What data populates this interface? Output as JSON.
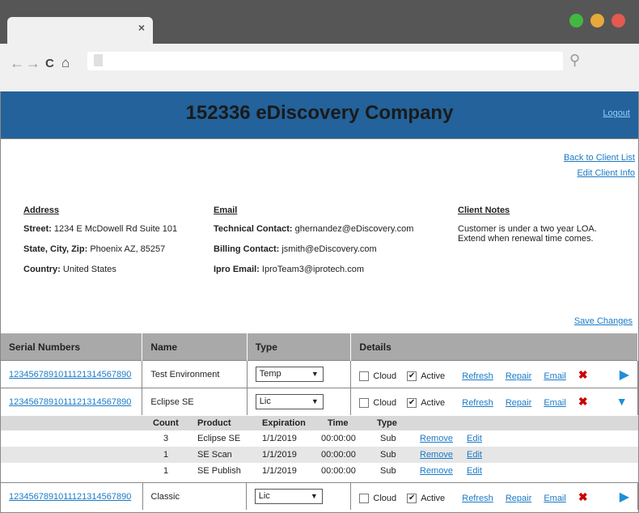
{
  "browser": {
    "tab_close": "×",
    "dots": [
      "#42b842",
      "#e8a93a",
      "#e35a4f"
    ],
    "nav": {
      "back": "←",
      "forward": "→",
      "reload": "C",
      "home": "⌂",
      "search": "⚲"
    }
  },
  "header": {
    "title": "152336 eDiscovery Company",
    "logout": "Logout"
  },
  "links": {
    "back": "Back to Client List",
    "edit": "Edit Client Info",
    "save": "Save Changes"
  },
  "address": {
    "heading": "Address",
    "street_label": "Street:",
    "street": "1234 E McDowell Rd Suite 101",
    "city_label": "State, City, Zip:",
    "city": "Phoenix AZ, 85257",
    "country_label": "Country:",
    "country": "United States"
  },
  "email": {
    "heading": "Email",
    "tech_label": "Technical Contact:",
    "tech": "ghernandez@eDiscovery.com",
    "billing_label": "Billing Contact:",
    "billing": "jsmith@eDiscovery.com",
    "ipro_label": "Ipro Email:",
    "ipro": "IproTeam3@iprotech.com"
  },
  "notes": {
    "heading": "Client Notes",
    "line1": "Customer is under a two year LOA.",
    "line2": "Extend when renewal time comes."
  },
  "table": {
    "headers": [
      "Serial Numbers",
      "Name",
      "Type",
      "Details"
    ],
    "rows": [
      {
        "serial": "1234567891011121314567890",
        "name": "Test Environment",
        "type": "Temp",
        "cloud": "Cloud",
        "active": "Active"
      },
      {
        "serial": "1234567891011121314567890",
        "name": "Eclipse SE",
        "type": "Lic",
        "cloud": "Cloud",
        "active": "Active"
      },
      {
        "serial": "1234567891011121314567890",
        "name": "Classic",
        "type": "Lic",
        "cloud": "Cloud",
        "active": "Active"
      }
    ],
    "actions": {
      "refresh": "Refresh",
      "repair": "Repair",
      "email": "Email"
    }
  },
  "sub": {
    "headers": [
      "Count",
      "Product",
      "Expiration",
      "Time",
      "Type"
    ],
    "rows": [
      {
        "count": "3",
        "product": "Eclipse SE",
        "exp": "1/1/2019",
        "time": "00:00:00",
        "type": "Sub"
      },
      {
        "count": "1",
        "product": "SE Scan",
        "exp": "1/1/2019",
        "time": "00:00:00",
        "type": "Sub"
      },
      {
        "count": "1",
        "product": "SE Publish",
        "exp": "1/1/2019",
        "time": "00:00:00",
        "type": "Sub"
      }
    ],
    "remove": "Remove",
    "edit": "Edit"
  }
}
